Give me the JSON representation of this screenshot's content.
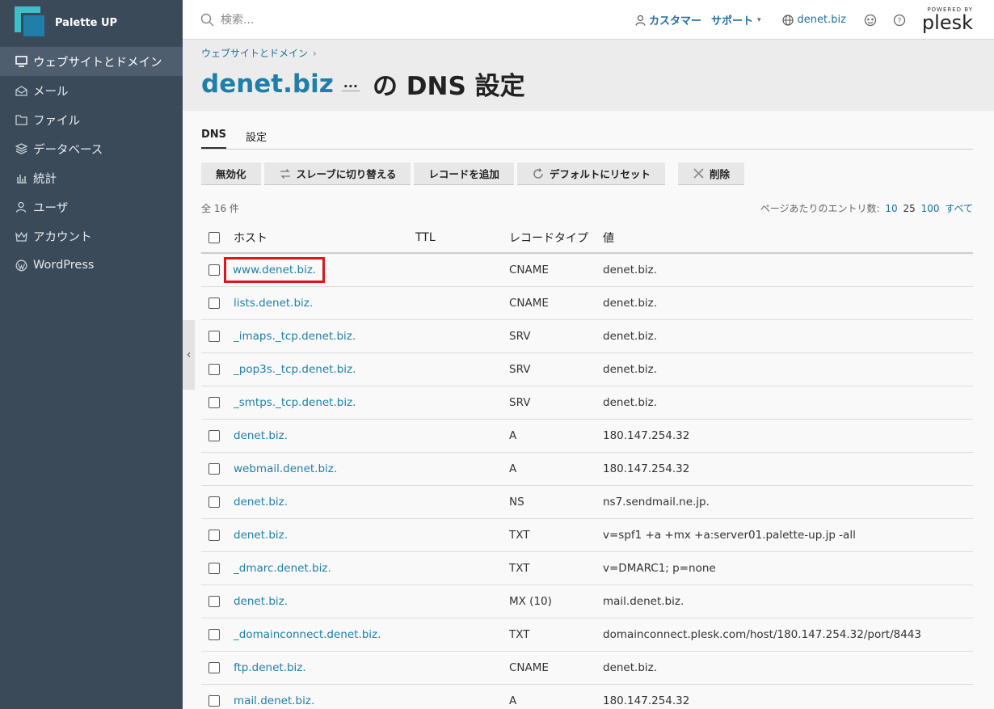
{
  "brand": {
    "name": "Palette UP"
  },
  "sidebar": {
    "items": [
      {
        "label": "ウェブサイトとドメイン",
        "icon": "monitor-icon",
        "active": true
      },
      {
        "label": "メール",
        "icon": "mail-icon"
      },
      {
        "label": "ファイル",
        "icon": "folder-icon"
      },
      {
        "label": "データベース",
        "icon": "database-icon"
      },
      {
        "label": "統計",
        "icon": "chart-icon"
      },
      {
        "label": "ユーザ",
        "icon": "user-icon"
      },
      {
        "label": "アカウント",
        "icon": "crown-icon"
      },
      {
        "label": "WordPress",
        "icon": "wordpress-icon"
      }
    ]
  },
  "header": {
    "search_placeholder": "検索...",
    "customer": "カスタマー",
    "support": "サポート",
    "domain": "denet.biz",
    "powered_by": "POWERED BY",
    "plesk": "plesk"
  },
  "breadcrumb": {
    "item": "ウェブサイトとドメイン"
  },
  "title": {
    "domain": "denet.biz",
    "more": "...",
    "rest": "の DNS 設定"
  },
  "tabs": [
    {
      "label": "DNS",
      "active": true
    },
    {
      "label": "設定"
    }
  ],
  "toolbar": {
    "disable": "無効化",
    "switch_slave": "スレーブに切り替える",
    "add_record": "レコードを追加",
    "reset_default": "デフォルトにリセット",
    "delete": "削除"
  },
  "list_meta": {
    "total": "全 16 件",
    "per_page_label": "ページあたりのエントリ数:",
    "per_page_options": [
      "10",
      "25",
      "100",
      "すべて"
    ],
    "per_page_current": "25"
  },
  "table": {
    "headers": {
      "host": "ホスト",
      "ttl": "TTL",
      "type": "レコードタイプ",
      "value": "値"
    },
    "rows": [
      {
        "host": "www.denet.biz.",
        "ttl": "",
        "type": "CNAME",
        "value": "denet.biz."
      },
      {
        "host": "lists.denet.biz.",
        "ttl": "",
        "type": "CNAME",
        "value": "denet.biz."
      },
      {
        "host": "_imaps._tcp.denet.biz.",
        "ttl": "",
        "type": "SRV",
        "value": "denet.biz."
      },
      {
        "host": "_pop3s._tcp.denet.biz.",
        "ttl": "",
        "type": "SRV",
        "value": "denet.biz."
      },
      {
        "host": "_smtps._tcp.denet.biz.",
        "ttl": "",
        "type": "SRV",
        "value": "denet.biz."
      },
      {
        "host": "denet.biz.",
        "ttl": "",
        "type": "A",
        "value": "180.147.254.32"
      },
      {
        "host": "webmail.denet.biz.",
        "ttl": "",
        "type": "A",
        "value": "180.147.254.32"
      },
      {
        "host": "denet.biz.",
        "ttl": "",
        "type": "NS",
        "value": "ns7.sendmail.ne.jp."
      },
      {
        "host": "denet.biz.",
        "ttl": "",
        "type": "TXT",
        "value": "v=spf1 +a +mx +a:server01.palette-up.jp -all"
      },
      {
        "host": "_dmarc.denet.biz.",
        "ttl": "",
        "type": "TXT",
        "value": "v=DMARC1; p=none"
      },
      {
        "host": "denet.biz.",
        "ttl": "",
        "type": "MX (10)",
        "value": "mail.denet.biz."
      },
      {
        "host": "_domainconnect.denet.biz.",
        "ttl": "",
        "type": "TXT",
        "value": "domainconnect.plesk.com/host/180.147.254.32/port/8443"
      },
      {
        "host": "ftp.denet.biz.",
        "ttl": "",
        "type": "CNAME",
        "value": "denet.biz."
      },
      {
        "host": "mail.denet.biz.",
        "ttl": "",
        "type": "A",
        "value": "180.147.254.32"
      }
    ]
  },
  "colors": {
    "sidebar": "#3b4a59",
    "link": "#1f7fa8",
    "highlight": "#e0141e"
  }
}
